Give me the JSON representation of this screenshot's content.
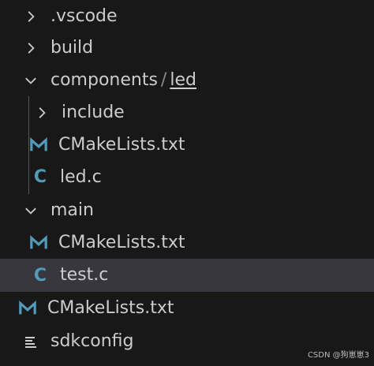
{
  "tree": {
    "vscode": {
      "label": ".vscode",
      "icon": "chevron-right-icon"
    },
    "build": {
      "label": "build",
      "icon": "chevron-right-icon"
    },
    "components": {
      "label": "components",
      "separator": "/",
      "sub": "led",
      "icon": "chevron-down-icon"
    },
    "include": {
      "label": "include",
      "icon": "chevron-right-icon"
    },
    "comp_cmake": {
      "label": "CMakeLists.txt",
      "icon": "cmake-icon"
    },
    "led_c": {
      "label": "led.c",
      "icon_text": "C",
      "icon": "c-file-icon"
    },
    "main": {
      "label": "main",
      "icon": "chevron-down-icon"
    },
    "main_cmake": {
      "label": "CMakeLists.txt",
      "icon": "cmake-icon"
    },
    "test_c": {
      "label": "test.c",
      "icon_text": "C",
      "icon": "c-file-icon",
      "selected": true
    },
    "root_cmake": {
      "label": "CMakeLists.txt",
      "icon": "cmake-icon"
    },
    "sdkconfig": {
      "label": "sdkconfig",
      "icon": "text-lines-icon"
    }
  },
  "colors": {
    "background": "#181818",
    "selected_row": "#37373d",
    "text": "#cccccc",
    "c_icon": "#519aba",
    "cmake_icon": "#519aba"
  },
  "watermark": "CSDN @狗崽崽3"
}
